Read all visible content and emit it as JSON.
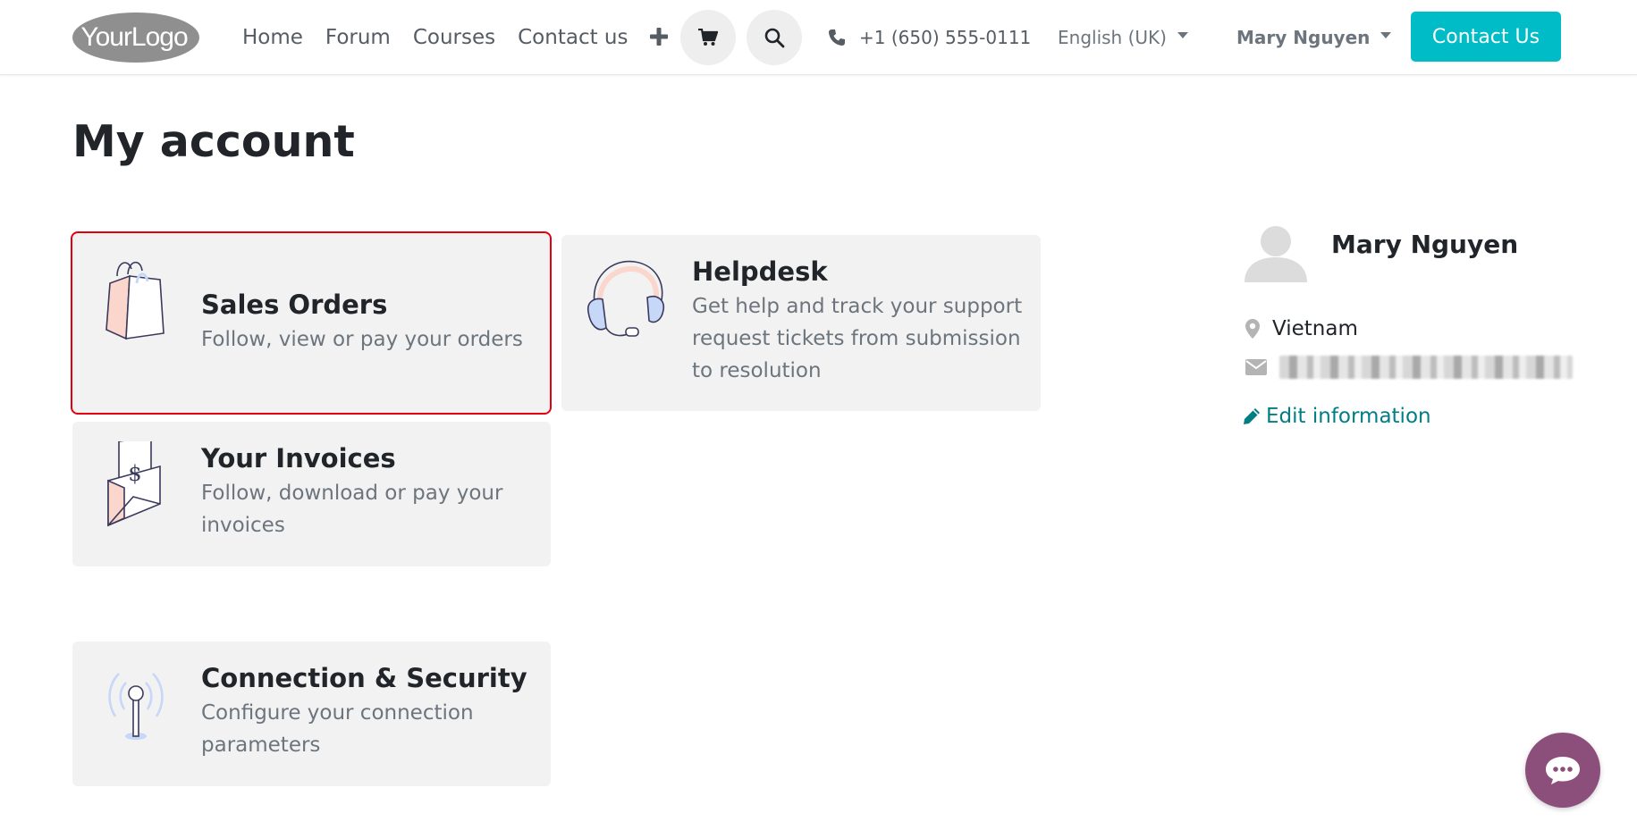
{
  "header": {
    "logo_text": "YourLogo",
    "nav": [
      "Home",
      "Forum",
      "Courses",
      "Contact us"
    ],
    "phone": "+1 (650) 555-0111",
    "language": "English (UK)",
    "user": "Mary Nguyen",
    "contact_button": "Contact Us"
  },
  "page": {
    "title": "My account"
  },
  "cards": [
    {
      "title": "Sales Orders",
      "desc_lines": [
        "Follow, view or pay your orders"
      ],
      "selected": true
    },
    {
      "title": "Helpdesk",
      "desc_lines": [
        "Get help and track your support",
        "request tickets from submission",
        "to resolution"
      ]
    },
    {
      "title": "Your Invoices",
      "desc_lines": [
        "Follow, download or pay your",
        "invoices"
      ]
    },
    {
      "title": "Connection & Security",
      "desc_lines": [
        "Configure your connection",
        "parameters"
      ]
    }
  ],
  "profile": {
    "name": "Mary Nguyen",
    "country": "Vietnam",
    "edit_label": "Edit information"
  },
  "colors": {
    "accent": "#00bcc7",
    "link": "#017e84",
    "selection": "#e3000f",
    "chat": "#8c4f7c"
  },
  "icons": {
    "cart": "cart-icon",
    "search": "search-icon",
    "phone": "phone-icon",
    "map_marker": "map-marker-icon",
    "envelope": "envelope-icon",
    "pencil": "pencil-icon",
    "chat": "chat-icon"
  }
}
